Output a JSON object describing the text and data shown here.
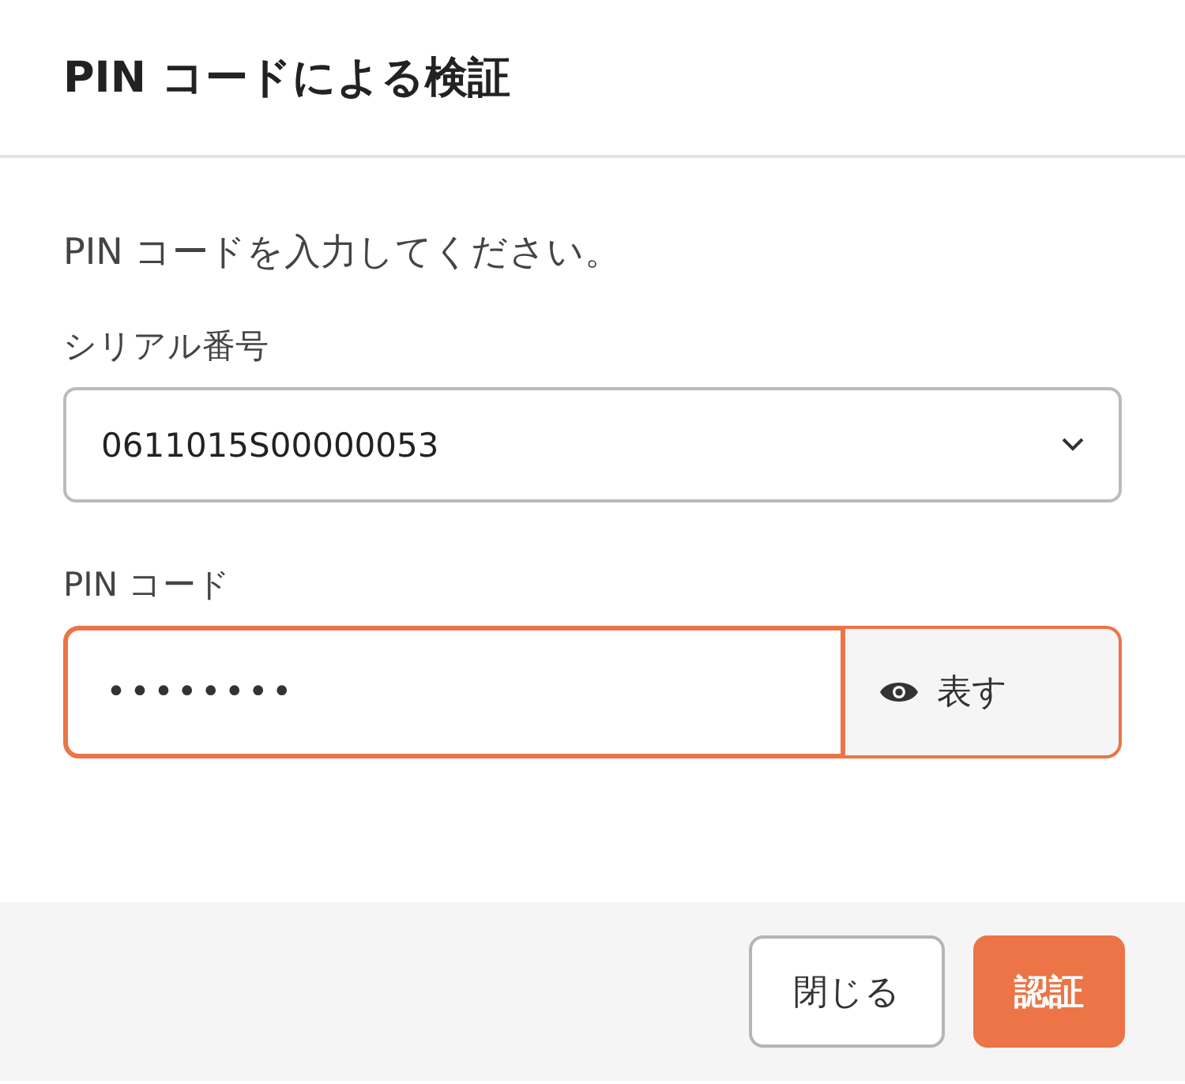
{
  "dialog": {
    "title": "PIN コードによる検証"
  },
  "instruction": "PIN コードを入力してください。",
  "serial": {
    "label": "シリアル番号",
    "value": "0611015S00000053"
  },
  "pin": {
    "label": "PIN コード",
    "value": "••••••••",
    "focused": true,
    "toggle_label": "表す"
  },
  "buttons": [
    {
      "label": "閉じる",
      "kind": "secondary"
    },
    {
      "label": "認証",
      "kind": "primary"
    }
  ]
}
